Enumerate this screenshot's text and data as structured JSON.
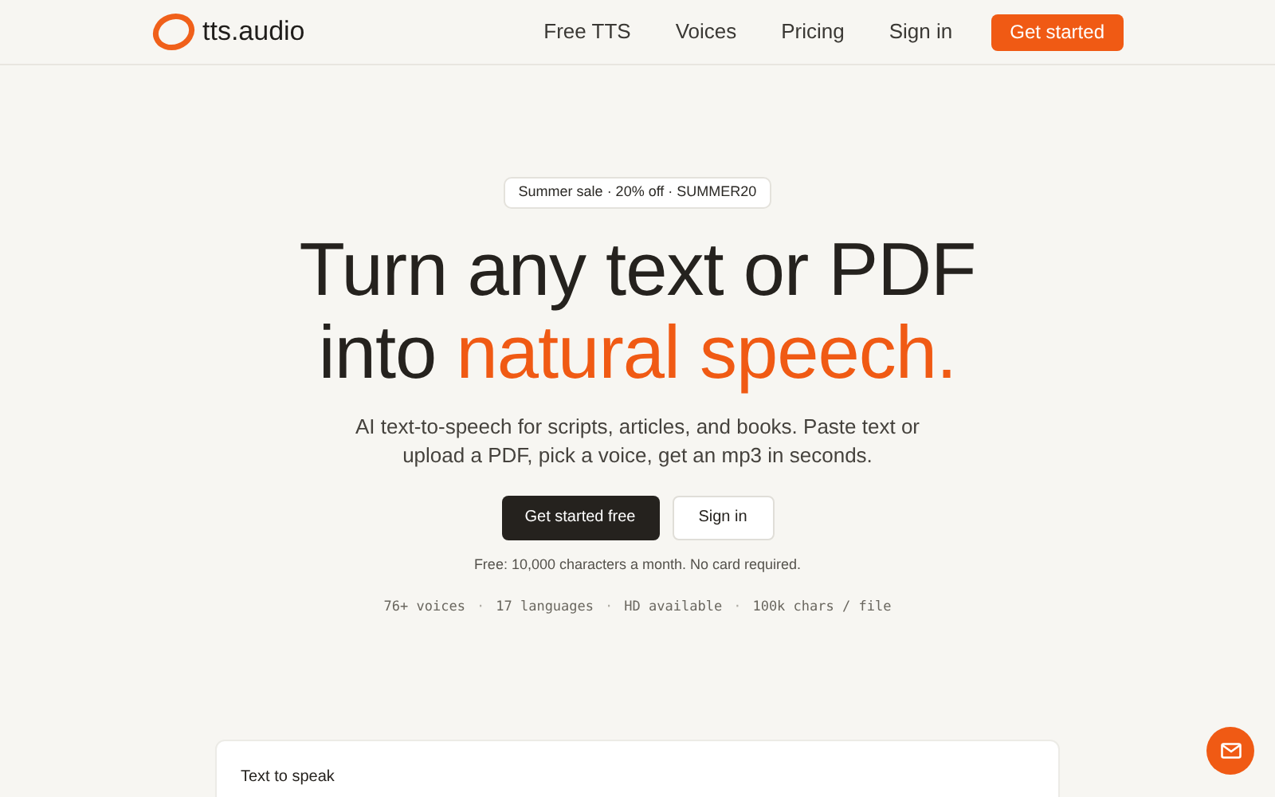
{
  "header": {
    "logo": "tts.audio",
    "nav": [
      "Free TTS",
      "Voices",
      "Pricing",
      "Sign in"
    ],
    "cta": "Get started"
  },
  "hero": {
    "badge": "Summer sale · 20% off · SUMMER20",
    "headline": {
      "line_1": "Turn any text or PDF",
      "line_2_plain": "into ",
      "line_2_highlight": "natural speech."
    },
    "subtitle": "AI text-to-speech for scripts, articles, and books. Paste text or upload a PDF, pick a voice, get an mp3 in seconds.",
    "buttons": [
      {
        "label": "Get started free",
        "kind": "primary"
      },
      {
        "label": "Sign in",
        "kind": "secondary"
      }
    ],
    "note": "Free: 10,000 characters a month. No card required.",
    "stats": [
      "76+ voices",
      "17 languages",
      "HD available",
      "100k chars / file"
    ],
    "stats_separator": "·"
  },
  "card": {
    "label": "Text to speak"
  }
}
